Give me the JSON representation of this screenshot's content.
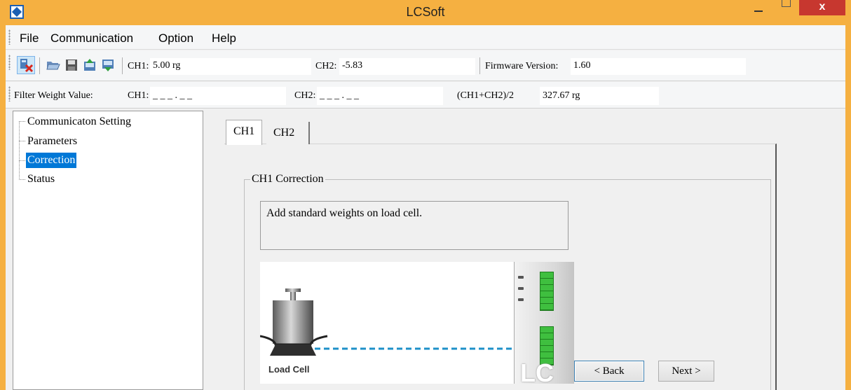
{
  "window": {
    "title": "LCSoft",
    "close_glyph": "x"
  },
  "menu": [
    {
      "label": "File"
    },
    {
      "label": "Communication"
    },
    {
      "label": "Option"
    },
    {
      "label": "Help"
    }
  ],
  "toolbar": {
    "ch1_label": "CH1:",
    "ch1_value": "5.00 rg",
    "ch2_label": "CH2:",
    "ch2_value": "-5.83",
    "firmware_label": "Firmware Version:",
    "firmware_value": "1.60",
    "icons": [
      "disconnect-icon",
      "open-folder-icon",
      "save-icon",
      "upload-icon",
      "download-icon"
    ]
  },
  "filter": {
    "label": "Filter Weight Value:",
    "ch1_label": "CH1:",
    "ch1_value": "_ _ _ . _ _",
    "ch2_label": "CH2:",
    "ch2_value": "_ _ _ . _ _",
    "avg_label": "(CH1+CH2)/2",
    "avg_value": "327.67 rg"
  },
  "tree": {
    "items": [
      {
        "label": "Communicaton Setting",
        "selected": false
      },
      {
        "label": "Parameters",
        "selected": false
      },
      {
        "label": "Correction",
        "selected": true
      },
      {
        "label": "Status",
        "selected": false
      }
    ]
  },
  "tabs": [
    {
      "label": "CH1",
      "active": true
    },
    {
      "label": "CH2",
      "active": false
    }
  ],
  "correction": {
    "group_title": "CH1 Correction",
    "message": "Add standard weights on load cell.",
    "load_cell_label": "Load Cell",
    "device_logo": "LC",
    "back_label": "< Back",
    "next_label": "Next >"
  },
  "colors": {
    "title_bar": "#f5b041",
    "close_button": "#c7372f",
    "selection": "#0078d7",
    "cable": "#1e90c8",
    "terminal": "#3fbf3f"
  }
}
